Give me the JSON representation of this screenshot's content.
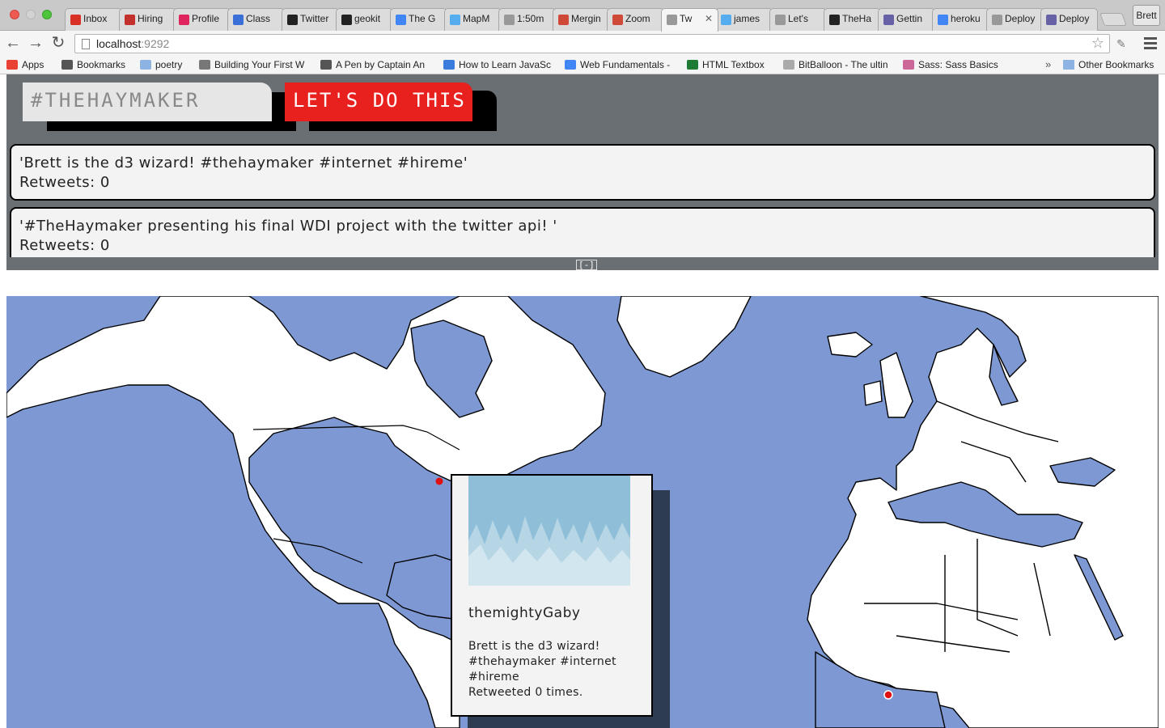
{
  "browser": {
    "tabs": [
      {
        "label": "Inbox",
        "icon": "gmail-icon",
        "color": "#d93025"
      },
      {
        "label": "Hiring",
        "icon": "hiring-icon",
        "color": "#c4302b"
      },
      {
        "label": "Profile",
        "icon": "profile-icon",
        "color": "#e0245e"
      },
      {
        "label": "Class",
        "icon": "class-icon",
        "color": "#3a6fd8"
      },
      {
        "label": "Twitter",
        "icon": "github-icon",
        "color": "#222222"
      },
      {
        "label": "geokit",
        "icon": "github-icon",
        "color": "#222222"
      },
      {
        "label": "The G",
        "icon": "google-icon",
        "color": "#4285f4"
      },
      {
        "label": "MapM",
        "icon": "twitter-icon",
        "color": "#55acee"
      },
      {
        "label": "1:50m",
        "icon": "page-icon",
        "color": "#999999"
      },
      {
        "label": "Mergin",
        "icon": "mergin-icon",
        "color": "#d04a3a"
      },
      {
        "label": "Zoom",
        "icon": "zoom-icon",
        "color": "#d04a3a"
      },
      {
        "label": "Tw",
        "icon": "page-icon",
        "color": "#999999",
        "active": true
      },
      {
        "label": "james",
        "icon": "twitter-icon",
        "color": "#55acee"
      },
      {
        "label": "Let's",
        "icon": "page-icon",
        "color": "#999999"
      },
      {
        "label": "TheHa",
        "icon": "github-icon",
        "color": "#222222"
      },
      {
        "label": "Gettin",
        "icon": "heroku-icon",
        "color": "#6762a6"
      },
      {
        "label": "heroku",
        "icon": "google-search-icon",
        "color": "#4285f4"
      },
      {
        "label": "Deploy",
        "icon": "page-icon",
        "color": "#999999"
      },
      {
        "label": "Deploy",
        "icon": "heroku-icon",
        "color": "#6762a6"
      }
    ],
    "user": "Brett",
    "url_host": "localhost",
    "url_port": ":9292",
    "bookmarks": [
      {
        "label": "Apps",
        "icon": "apps-grid-icon"
      },
      {
        "label": "Bookmarks",
        "icon": "star-icon"
      },
      {
        "label": "poetry",
        "icon": "folder-icon"
      },
      {
        "label": "Building Your First W",
        "icon": "code-icon"
      },
      {
        "label": "A Pen by Captain An",
        "icon": "codepen-icon"
      },
      {
        "label": "How to Learn JavaSc",
        "icon": "js-icon"
      },
      {
        "label": "Web Fundamentals -",
        "icon": "google-icon"
      },
      {
        "label": "HTML Textbox",
        "icon": "html-icon"
      },
      {
        "label": "BitBalloon - The ultin",
        "icon": "page-icon"
      },
      {
        "label": "Sass: Sass Basics",
        "icon": "sass-icon"
      }
    ],
    "bookmarks_more": "»",
    "other_bookmarks": "Other Bookmarks"
  },
  "search": {
    "placeholder": "#THEHAYMAKER",
    "button_label": "LET'S DO THIS"
  },
  "tweets": [
    {
      "text": "'Brett is the d3 wizard! #thehaymaker #internet #hireme'",
      "retweets": "Retweets: 0"
    },
    {
      "text": "'#TheHaymaker presenting his final WDI project with the twitter api! '",
      "retweets": "Retweets: 0"
    }
  ],
  "collapse_label": "[-]",
  "popup": {
    "username": "themightyGaby",
    "text": "Brett is the d3 wizard! #thehaymaker #internet #hireme",
    "retweeted": "Retweeted 0 times."
  },
  "colors": {
    "ocean": "#7d98d2",
    "land": "#ffffff",
    "accent_red": "#e8201e",
    "panel_gray": "#6a6f74",
    "marker": "#e01010"
  }
}
